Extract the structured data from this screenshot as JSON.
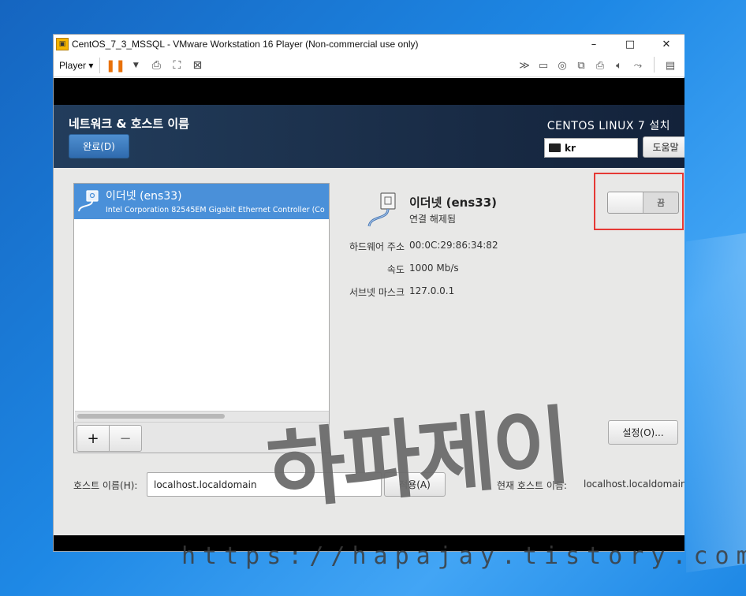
{
  "window": {
    "title": "CentOS_7_3_MSSQL - VMware Workstation 16 Player (Non-commercial use only)",
    "minimize": "–",
    "maximize": "□",
    "close": "✕"
  },
  "toolbar": {
    "player_menu": "Player ▾",
    "pause_icon": "pause-icon"
  },
  "anaconda": {
    "spoke_title": "네트워크 & 호스트 이름",
    "done_button": "완료(D)",
    "product_title": "CENTOS LINUX 7 설치",
    "keyboard_layout": "kr",
    "help_button": "도움말"
  },
  "device_list": {
    "items": [
      {
        "name": "이더넷 (ens33)",
        "description": "Intel Corporation 82545EM Gigabit Ethernet Controller (Co"
      }
    ],
    "add_button": "+",
    "remove_button": "−"
  },
  "device_detail": {
    "name": "이더넷 (ens33)",
    "status": "연결 해제됨",
    "properties": [
      {
        "label": "하드웨어 주소",
        "value": "00:0C:29:86:34:82"
      },
      {
        "label": "속도",
        "value": "1000 Mb/s"
      },
      {
        "label": "서브넷 마스크",
        "value": "127.0.0.1"
      }
    ],
    "toggle_label": "끔",
    "configure_button": "설정(O)..."
  },
  "hostname": {
    "label": "호스트 이름(H):",
    "value": "localhost.localdomain",
    "apply_button": "적용(A)",
    "current_label": "현재 호스트 이름:",
    "current_value": "localhost.localdomain"
  },
  "watermark": {
    "text": "하파제이",
    "url": "https://hapajay.tistory.com/"
  },
  "colors": {
    "selection": "#4a90d9",
    "header": "#1b2f4a",
    "highlight_box": "#e53935",
    "desktop": "#1e88e5"
  }
}
